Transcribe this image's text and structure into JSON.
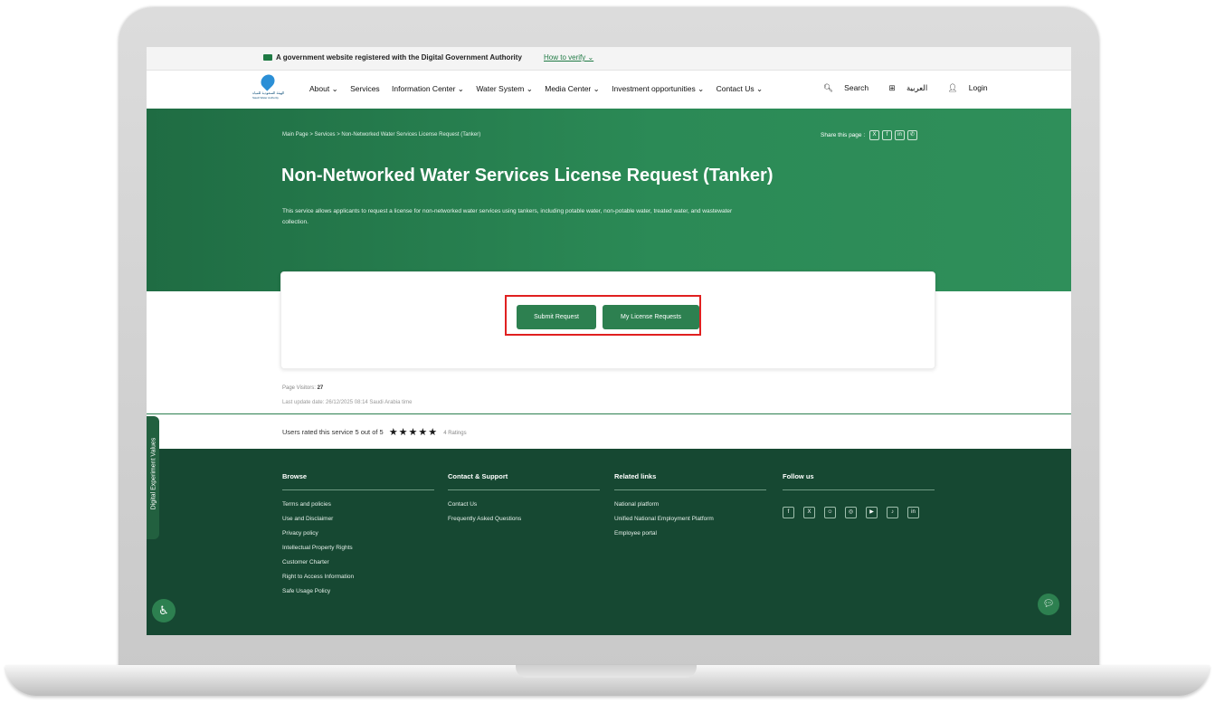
{
  "govbar": {
    "text": "A government website registered with the Digital Government Authority",
    "verify": "How to verify ⌄"
  },
  "logo": {
    "text_ar": "الهيئة السعودية للمياه",
    "text_en": "Saudi Water Authority"
  },
  "nav": {
    "items": [
      "About ⌄",
      "Services",
      "Information Center ⌄",
      "Water System ⌄",
      "Media Center ⌄",
      "Investment opportunities ⌄",
      "Contact Us ⌄"
    ],
    "search": "Search",
    "language": "العربية",
    "login": "Login"
  },
  "breadcrumb": "Main Page  >  Services  >  Non-Networked Water Services License Request (Tanker)",
  "share": {
    "label": "Share this page :",
    "icons": [
      "x-icon",
      "facebook-icon",
      "linkedin-icon",
      "whatsapp-icon"
    ]
  },
  "hero": {
    "title": "Non-Networked Water Services License Request (Tanker)",
    "description": "This service allows applicants to request a license for non-networked water services using tankers, including potable water, non-potable water, treated water, and wastewater collection."
  },
  "actions": {
    "submit": "Submit Request",
    "my_requests": "My License Requests"
  },
  "meta": {
    "visitors_label": "Page Visitors: ",
    "visitors_value": "27",
    "last_update": "Last update date: 26/12/2025 08:14 Saudi Arabia time"
  },
  "rating": {
    "text": "Users rated this service 5 out of 5",
    "stars": "★★★★★",
    "count": "4 Ratings"
  },
  "footer": {
    "browse": {
      "title": "Browse",
      "links": [
        "Terms and policies",
        "Use and Disclaimer",
        "Privacy policy",
        "Intellectual Property Rights",
        "Customer Charter",
        "Right to Access Information",
        "Safe Usage Policy"
      ]
    },
    "contact": {
      "title": "Contact & Support",
      "links": [
        "Contact Us",
        "Frequently Asked Questions"
      ]
    },
    "related": {
      "title": "Related links",
      "links": [
        "National platform",
        "Unified National Employment Platform",
        "Employee portal"
      ]
    },
    "follow": {
      "title": "Follow us",
      "icons": [
        "facebook-icon",
        "x-icon",
        "snapchat-icon",
        "instagram-icon",
        "youtube-icon",
        "tiktok-icon",
        "linkedin-icon"
      ]
    }
  },
  "side_tab": "Digital Experiment Values",
  "colors": {
    "primary": "#2d8050",
    "footer": "#164832",
    "highlight": "#e02020"
  }
}
